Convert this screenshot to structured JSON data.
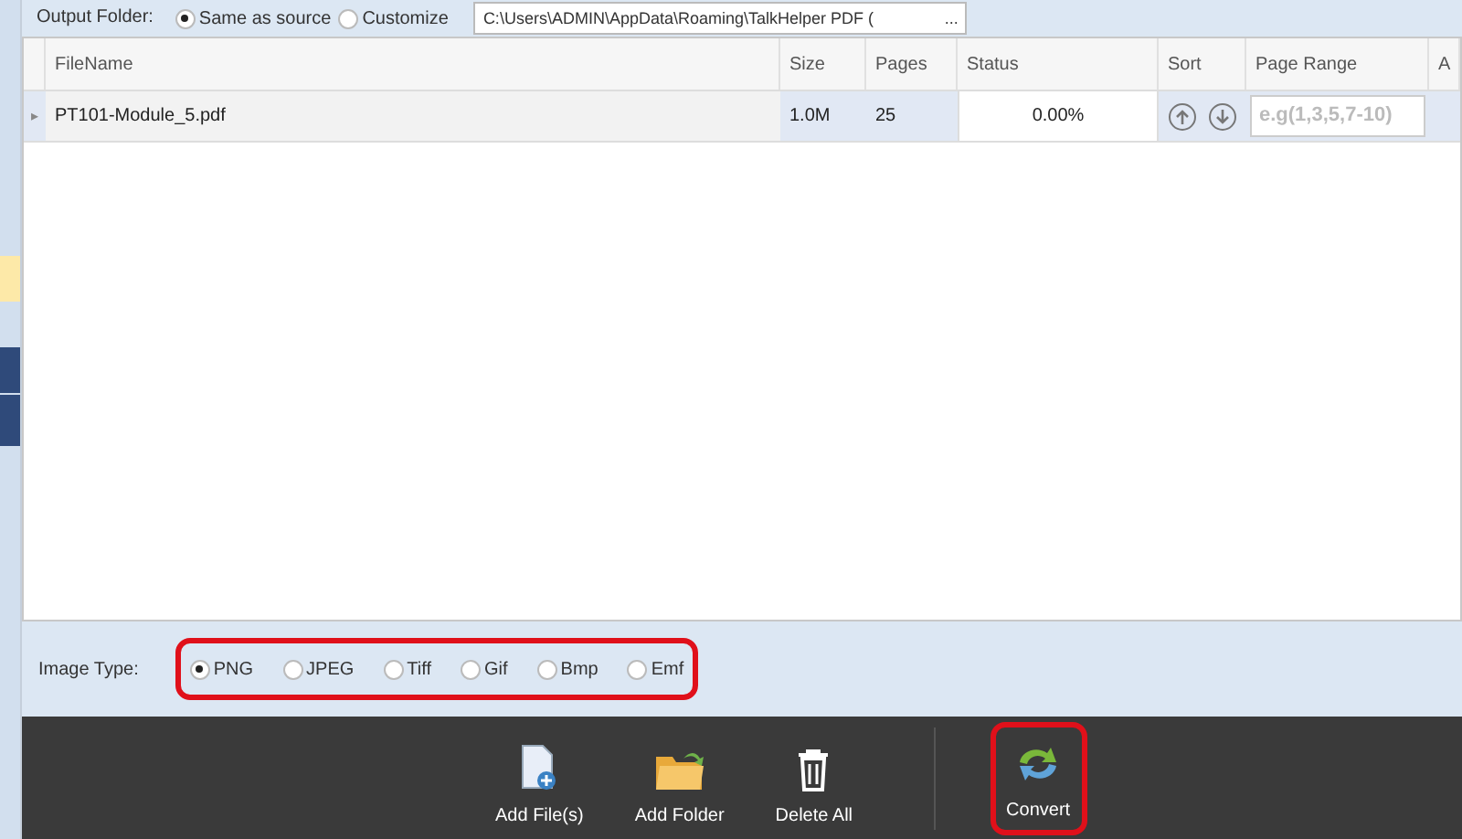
{
  "output_folder": {
    "label": "Output Folder:",
    "options": [
      {
        "label": "Same as source",
        "selected": true
      },
      {
        "label": "Customize",
        "selected": false
      }
    ],
    "path": "C:\\Users\\ADMIN\\AppData\\Roaming\\TalkHelper PDF (",
    "browse": "..."
  },
  "table": {
    "columns": [
      "FileName",
      "Size",
      "Pages",
      "Status",
      "Sort",
      "Page Range",
      "A"
    ],
    "rows": [
      {
        "expand": "▸",
        "file": "PT101-Module_5.pdf",
        "size": "1.0M",
        "pages": "25",
        "status": "0.00%",
        "page_range_placeholder": "e.g(1,3,5,7-10)",
        "selected": true
      }
    ]
  },
  "image_type": {
    "label": "Image Type:",
    "options": [
      {
        "label": "PNG",
        "selected": true
      },
      {
        "label": "JPEG",
        "selected": false
      },
      {
        "label": "Tiff",
        "selected": false
      },
      {
        "label": "Gif",
        "selected": false
      },
      {
        "label": "Bmp",
        "selected": false
      },
      {
        "label": "Emf",
        "selected": false
      }
    ]
  },
  "toolbar": [
    {
      "kind": "add-file",
      "label": "Add File(s)",
      "highlighted": false
    },
    {
      "kind": "add-folder",
      "label": "Add Folder",
      "highlighted": false
    },
    {
      "kind": "delete",
      "label": "Delete All",
      "highlighted": false
    },
    {
      "kind": "convert",
      "label": "Convert",
      "highlighted": true
    }
  ]
}
